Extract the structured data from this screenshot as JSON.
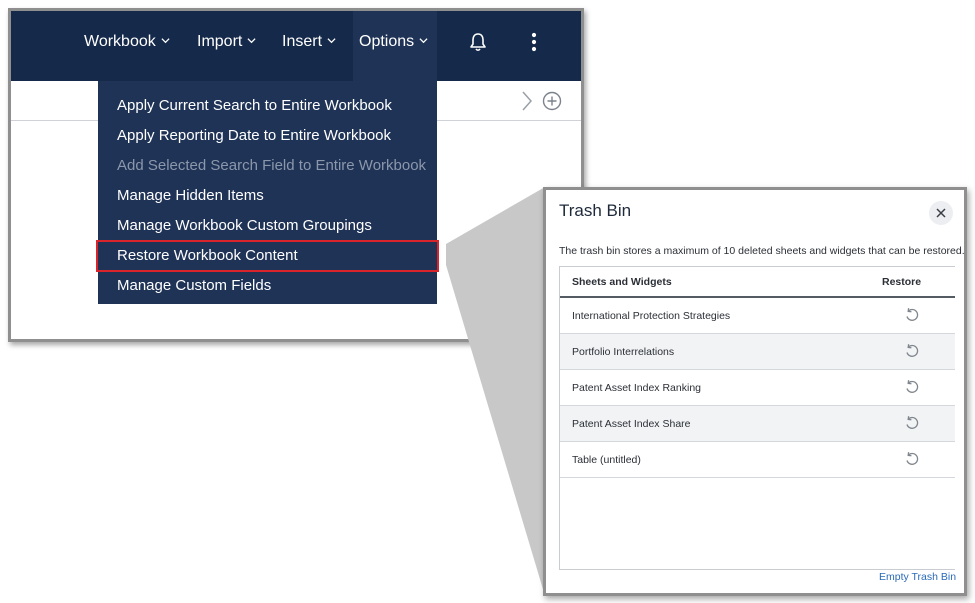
{
  "nav": {
    "items": [
      {
        "label": "Workbook"
      },
      {
        "label": "Import"
      },
      {
        "label": "Insert"
      },
      {
        "label": "Options"
      }
    ],
    "icons": [
      "bell-icon",
      "more-vertical-icon"
    ]
  },
  "toolbar": {
    "icons": [
      "chevron-right-icon",
      "add-circle-icon"
    ]
  },
  "options_menu": {
    "items": [
      {
        "label": "Apply Current Search to Entire Workbook",
        "disabled": false
      },
      {
        "label": "Apply Reporting Date to Entire Workbook",
        "disabled": false
      },
      {
        "label": "Add Selected Search Field to Entire Workbook",
        "disabled": true
      },
      {
        "label": "Manage Hidden Items",
        "disabled": false
      },
      {
        "label": "Manage Workbook Custom Groupings",
        "disabled": false
      },
      {
        "label": "Restore Workbook Content",
        "disabled": false,
        "highlighted": true
      },
      {
        "label": "Manage Custom Fields",
        "disabled": false
      }
    ]
  },
  "trash_bin": {
    "title": "Trash Bin",
    "description": "The trash bin stores a maximum of 10 deleted sheets and widgets that can be restored.",
    "columns": {
      "name": "Sheets and Widgets",
      "restore": "Restore"
    },
    "rows": [
      {
        "name": "International Protection Strategies"
      },
      {
        "name": "Portfolio Interrelations"
      },
      {
        "name": "Patent Asset Index Ranking"
      },
      {
        "name": "Patent Asset Index Share"
      },
      {
        "name": "Table (untitled)"
      }
    ],
    "empty_link": "Empty Trash Bin"
  },
  "colors": {
    "nav_bg": "#15294a",
    "menu_bg": "#1f3357",
    "highlight": "#d9242b",
    "link": "#2a6ab8"
  }
}
